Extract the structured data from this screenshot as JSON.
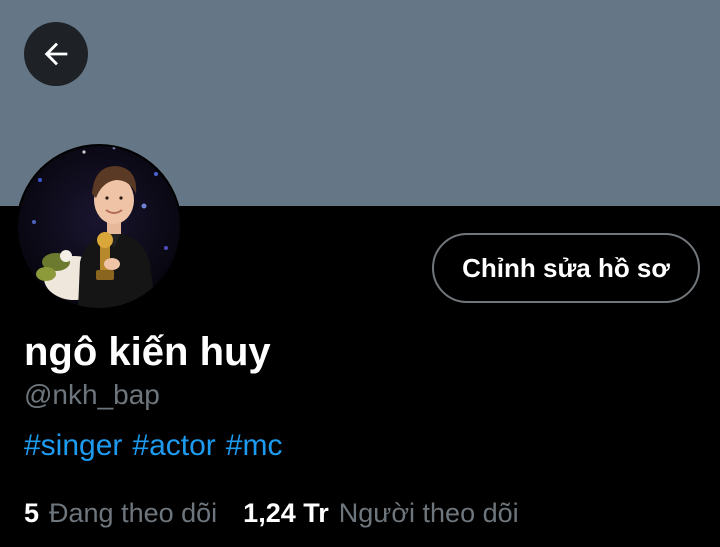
{
  "banner": {
    "color": "#657786"
  },
  "header": {
    "back_icon": "arrow-left-icon"
  },
  "profile": {
    "edit_button_label": "Chỉnh sửa hồ sơ",
    "display_name": "ngô kiến huy",
    "handle": "@nkh_bap",
    "bio_hashtags": [
      "#singer",
      "#actor",
      "#mc"
    ]
  },
  "stats": {
    "following_count": "5",
    "following_label": "Đang theo dõi",
    "followers_count": "1,24 Tr",
    "followers_label": "Người theo dõi"
  },
  "colors": {
    "background": "#000000",
    "link": "#1d9bf0",
    "secondary_text": "#6e767d",
    "button_border": "#71767b"
  }
}
